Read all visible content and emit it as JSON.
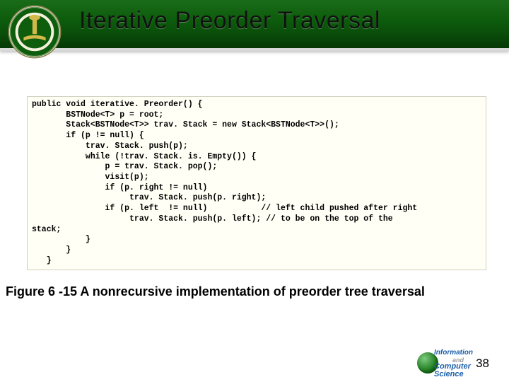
{
  "header": {
    "title": "Iterative Preorder Traversal",
    "crest_label": "university-crest"
  },
  "code": {
    "text": "public void iterative. Preorder() {\n       BSTNode<T> p = root;\n       Stack<BSTNode<T>> trav. Stack = new Stack<BSTNode<T>>();\n       if (p != null) {\n           trav. Stack. push(p);\n           while (!trav. Stack. is. Empty()) {\n               p = trav. Stack. pop();\n               visit(p);\n               if (p. right != null)\n                    trav. Stack. push(p. right);\n               if (p. left  != null)           // left child pushed after right\n                    trav. Stack. push(p. left); // to be on the top of the\nstack;\n           }\n       }\n   }"
  },
  "caption": "Figure 6 -15 A nonrecursive implementation of preorder tree traversal",
  "page_number": "38",
  "footer": {
    "line1": "Information",
    "and": "and",
    "line2": "Computer Science"
  }
}
